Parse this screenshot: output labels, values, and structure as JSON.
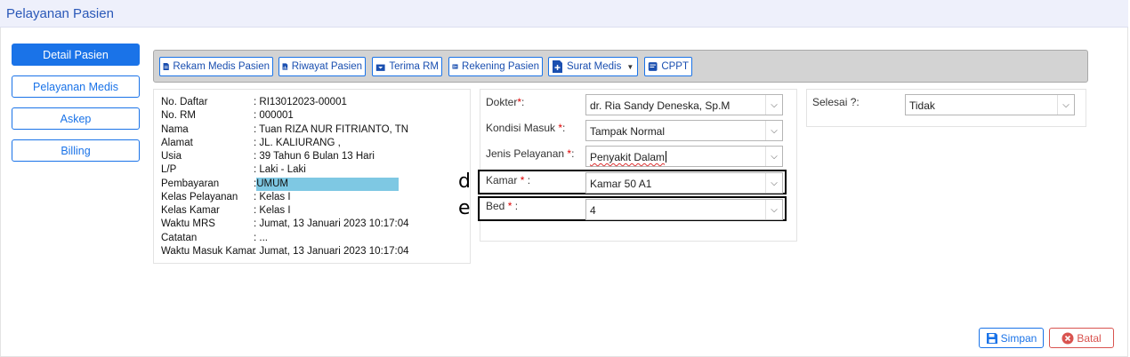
{
  "page": {
    "title": "Pelayanan Pasien"
  },
  "nav": {
    "items": [
      {
        "label": "Detail Pasien",
        "active": true
      },
      {
        "label": "Pelayanan Medis",
        "active": false
      },
      {
        "label": "Askep",
        "active": false
      },
      {
        "label": "Billing",
        "active": false
      }
    ]
  },
  "toolbar": {
    "rekam_medis": "Rekam Medis Pasien",
    "riwayat": "Riwayat Pasien",
    "terima_rm": "Terima RM",
    "rekening": "Rekening Pasien",
    "surat_medis": "Surat Medis",
    "cppt": "CPPT"
  },
  "patient": {
    "rows": [
      {
        "label": "No. Daftar",
        "value": ": RI13012023-00001"
      },
      {
        "label": "No. RM",
        "value": ": 000001"
      },
      {
        "label": "Nama",
        "value": ": Tuan RIZA NUR FITRIANTO, TN"
      },
      {
        "label": "Alamat",
        "value": ": JL. KALIURANG ,"
      },
      {
        "label": "Usia",
        "value": ": 39 Tahun 6 Bulan 13 Hari"
      },
      {
        "label": "L/P",
        "value": ": Laki - Laki"
      },
      {
        "label": "Pembayaran",
        "value_prefix": ":",
        "value": "UMUM"
      },
      {
        "label": "Kelas Pelayanan",
        "value": ": Kelas I"
      },
      {
        "label": "Kelas Kamar",
        "value": ": Kelas I"
      },
      {
        "label": "Waktu MRS",
        "value": ": Jumat, 13 Januari 2023 10:17:04"
      },
      {
        "label": "Catatan",
        "value": ": ..."
      },
      {
        "label": "Waktu Masuk Kamar",
        "value": ": Jumat, 13 Januari 2023 10:17:04"
      }
    ]
  },
  "form": {
    "dokter": {
      "label": "Dokter",
      "suffix": ":",
      "value": "dr. Ria Sandy Deneska, Sp.M"
    },
    "kondisi": {
      "label": "Kondisi Masuk ",
      "suffix": ":",
      "value": "Tampak Normal"
    },
    "jenis": {
      "label": "Jenis Pelayanan ",
      "suffix": ":",
      "value": "Penyakit Dalam"
    },
    "kamar": {
      "label": "Kamar ",
      "suffix": " :",
      "value": "Kamar 50 A1"
    },
    "bed": {
      "label": "Bed ",
      "suffix": " :",
      "value": "4"
    },
    "required_mark": "*"
  },
  "annotations": {
    "d": "d",
    "e": "e"
  },
  "selesai": {
    "label": "Selesai ?:",
    "value": "Tidak"
  },
  "footer": {
    "save": "Simpan",
    "cancel": "Batal"
  },
  "colors": {
    "primary": "#1a73e8",
    "danger": "#d9534f",
    "highlight": "#7ec8e3"
  }
}
